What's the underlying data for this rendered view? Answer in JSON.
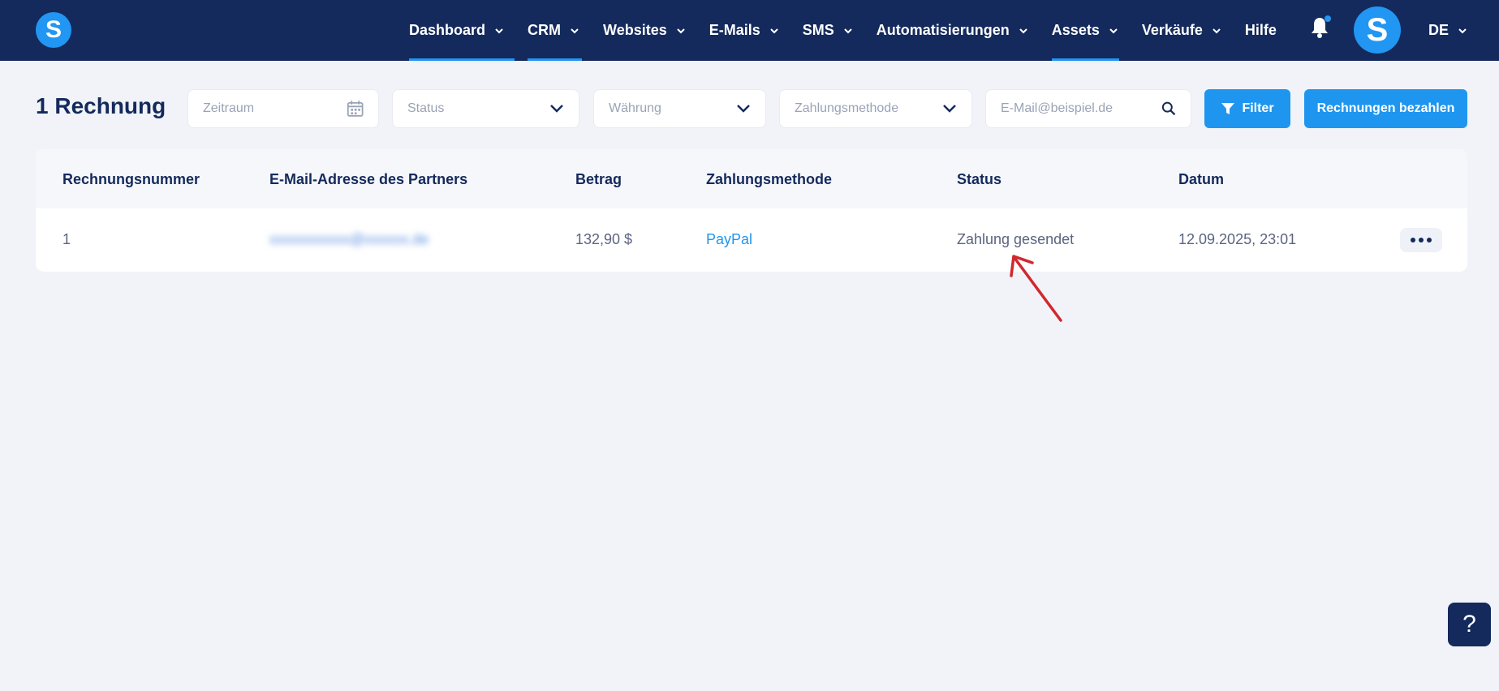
{
  "app": {
    "logo_letter": "S",
    "avatar_letter": "S",
    "brand_color": "#2196f3",
    "nav_bg": "#142a5c"
  },
  "nav": {
    "items": [
      {
        "label": "Dashboard",
        "has_dropdown": true,
        "active": true
      },
      {
        "label": "CRM",
        "has_dropdown": true,
        "active": true
      },
      {
        "label": "Websites",
        "has_dropdown": true,
        "active": false
      },
      {
        "label": "E-Mails",
        "has_dropdown": true,
        "active": false
      },
      {
        "label": "SMS",
        "has_dropdown": true,
        "active": false
      },
      {
        "label": "Automatisierungen",
        "has_dropdown": true,
        "active": false
      },
      {
        "label": "Assets",
        "has_dropdown": true,
        "active": true
      },
      {
        "label": "Verkäufe",
        "has_dropdown": true,
        "active": false
      },
      {
        "label": "Hilfe",
        "has_dropdown": false,
        "active": false
      }
    ],
    "language": "DE",
    "notifications_icon": "bell-icon"
  },
  "toolbar": {
    "title": "1 Rechnung",
    "period_placeholder": "Zeitraum",
    "status_placeholder": "Status",
    "currency_placeholder": "Währung",
    "payment_method_placeholder": "Zahlungsmethode",
    "email_placeholder": "E-Mail@beispiel.de",
    "filter_label": "Filter",
    "pay_invoices_label": "Rechnungen bezahlen"
  },
  "table": {
    "headers": {
      "number": "Rechnungsnummer",
      "email": "E-Mail-Adresse des Partners",
      "amount": "Betrag",
      "method": "Zahlungsmethode",
      "status": "Status",
      "date": "Datum"
    },
    "rows": [
      {
        "number": "1",
        "email": "xxxxxxxxxxx@xxxxxx.de",
        "amount": "132,90 $",
        "method": "PayPal",
        "status": "Zahlung gesendet",
        "date": "12.09.2025, 23:01"
      }
    ]
  },
  "help": {
    "label": "?"
  }
}
